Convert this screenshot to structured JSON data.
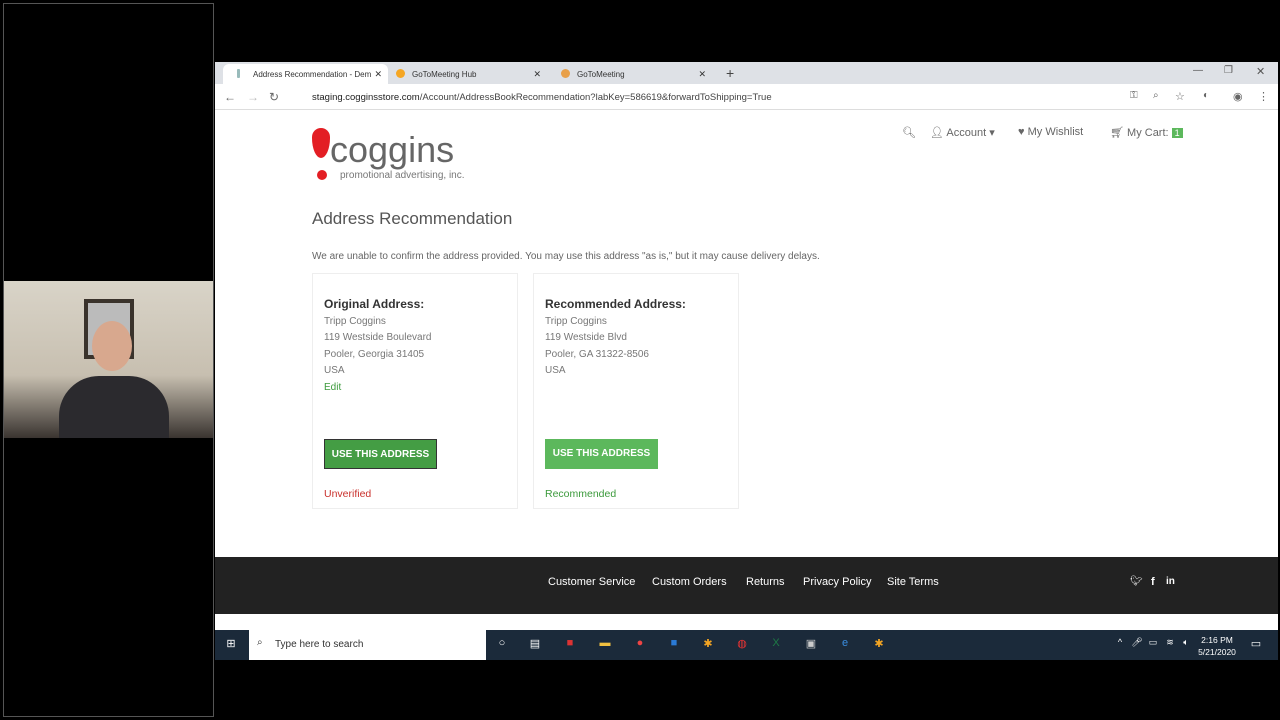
{
  "browser": {
    "tabs": [
      {
        "label": "Address Recommendation - Dem",
        "active": true
      },
      {
        "label": "GoToMeeting Hub"
      },
      {
        "label": "GoToMeeting"
      }
    ],
    "url_host": "staging.cogginsstore.com",
    "url_path": "/Account/AddressBookRecommendation?labKey=586619&forwardToShipping=True"
  },
  "logo": {
    "name": "coggins",
    "tagline": "promotional advertising, inc."
  },
  "header": {
    "account": "Account",
    "wishlist": "My Wishlist",
    "cart": "My Cart:",
    "cart_count": "1"
  },
  "page": {
    "title": "Address Recommendation",
    "message": "We are unable to confirm the address provided. You may use this address \"as is,\" but it may cause delivery delays.",
    "original": {
      "heading": "Original Address:",
      "lines": [
        "Tripp Coggins",
        "119 Westside Boulevard",
        "Pooler, Georgia 31405",
        "USA"
      ],
      "edit": "Edit",
      "button": "USE THIS ADDRESS",
      "status": "Unverified"
    },
    "recommended": {
      "heading": "Recommended Address:",
      "lines": [
        "Tripp Coggins",
        "119 Westside Blvd",
        "Pooler, GA 31322-8506",
        "USA"
      ],
      "button": "USE THIS ADDRESS",
      "status": "Recommended"
    }
  },
  "footer": {
    "links": [
      "Customer Service",
      "Custom Orders",
      "Returns",
      "Privacy Policy",
      "Site Terms"
    ]
  },
  "taskbar": {
    "search_placeholder": "Type here to search",
    "time": "2:16 PM",
    "date": "5/21/2020"
  },
  "colors": {
    "accent": "#5cb85c",
    "unverified": "#c9302c",
    "recommended": "#3c9a3c"
  }
}
